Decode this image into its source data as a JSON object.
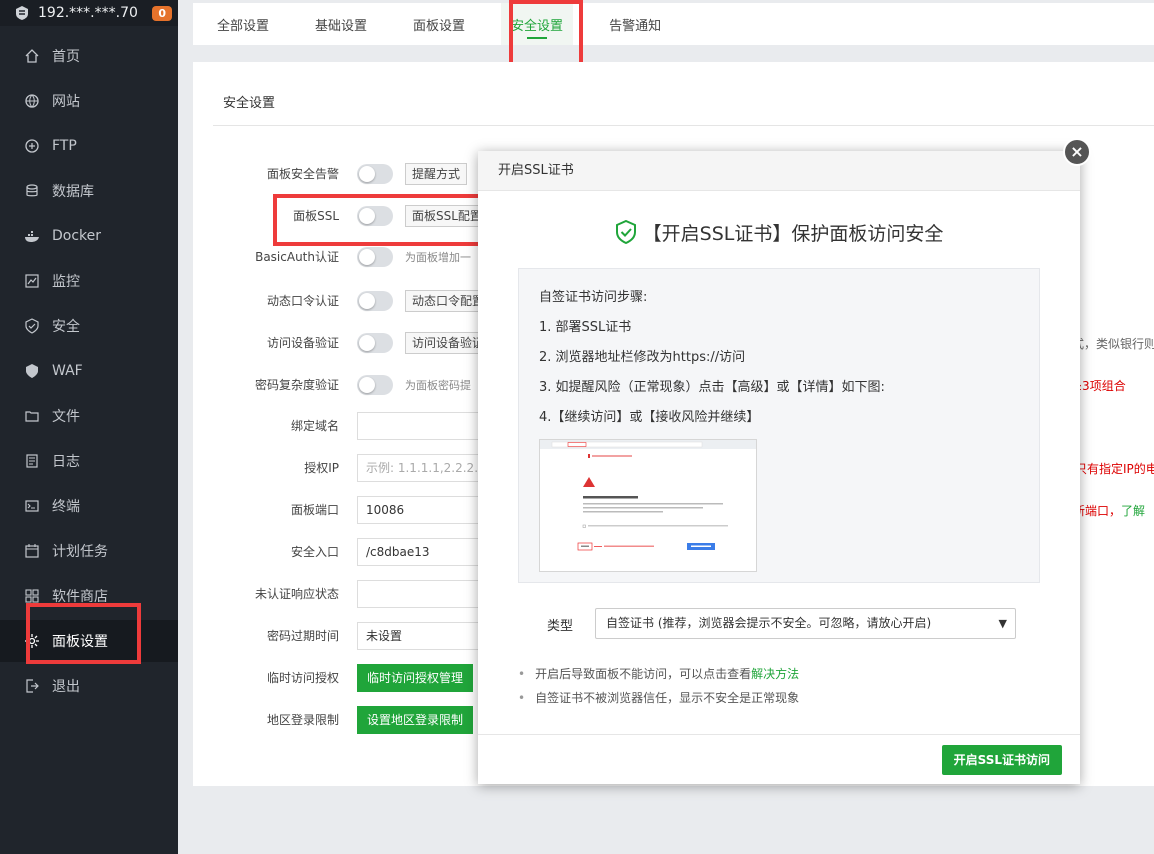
{
  "server": {
    "ip": "192.***.***.70",
    "badge": "0"
  },
  "sidebar": {
    "items": [
      {
        "label": "首页",
        "icon": "home-icon"
      },
      {
        "label": "网站",
        "icon": "globe-icon"
      },
      {
        "label": "FTP",
        "icon": "ftp-icon"
      },
      {
        "label": "数据库",
        "icon": "database-icon"
      },
      {
        "label": "Docker",
        "icon": "docker-icon"
      },
      {
        "label": "监控",
        "icon": "monitor-icon"
      },
      {
        "label": "安全",
        "icon": "shield-icon"
      },
      {
        "label": "WAF",
        "icon": "waf-shield-icon"
      },
      {
        "label": "文件",
        "icon": "folder-icon"
      },
      {
        "label": "日志",
        "icon": "log-icon"
      },
      {
        "label": "终端",
        "icon": "terminal-icon"
      },
      {
        "label": "计划任务",
        "icon": "calendar-icon"
      },
      {
        "label": "软件商店",
        "icon": "apps-icon"
      },
      {
        "label": "面板设置",
        "icon": "gear-icon",
        "active": true
      },
      {
        "label": "退出",
        "icon": "logout-icon"
      }
    ]
  },
  "tabs": [
    "全部设置",
    "基础设置",
    "面板设置",
    "安全设置",
    "告警通知"
  ],
  "active_tab": "安全设置",
  "panel": {
    "title": "安全设置",
    "rows": {
      "alert": {
        "label": "面板安全告警",
        "button": "提醒方式"
      },
      "ssl": {
        "label": "面板SSL",
        "button": "面板SSL配置"
      },
      "basicauth": {
        "label": "BasicAuth认证",
        "hint": "为面板增加一"
      },
      "totp": {
        "label": "动态口令认证",
        "button": "动态口令配置"
      },
      "device": {
        "label": "访问设备验证",
        "button": "访问设备验证",
        "right": "式，类似银行则"
      },
      "complexity": {
        "label": "密码复杂度验证",
        "hint": "为面板密码提",
        "right": "≥3项组合"
      },
      "domain": {
        "label": "绑定域名",
        "value": ""
      },
      "ip": {
        "label": "授权IP",
        "placeholder": "示例: 1.1.1.1,2.2.2.1-",
        "right": "只有指定IP的电"
      },
      "port": {
        "label": "面板端口",
        "value": "10086",
        "right_red": "新端口，",
        "right_green": "了解"
      },
      "entry": {
        "label": "安全入口",
        "value": "/c8dbae13"
      },
      "unauth": {
        "label": "未认证响应状态",
        "value": ""
      },
      "pwexpire": {
        "label": "密码过期时间",
        "value": "未设置"
      },
      "tempauth": {
        "label": "临时访问授权",
        "button": "临时访问授权管理"
      },
      "region": {
        "label": "地区登录限制",
        "button": "设置地区登录限制"
      }
    }
  },
  "modal": {
    "header": "开启SSL证书",
    "title": "【开启SSL证书】保护面板访问安全",
    "steps_title": "自签证书访问步骤:",
    "steps": [
      "1. 部署SSL证书",
      "2. 浏览器地址栏修改为https://访问",
      "3. 如提醒风险（正常现象）点击【高级】或【详情】如下图:",
      "4.【继续访问】或【接收风险并继续】"
    ],
    "type_label": "类型",
    "type_value": "自签证书 (推荐，浏览器会提示不安全。可忽略，请放心开启)",
    "notes": [
      {
        "text": "开启后导致面板不能访问，可以点击查看",
        "link": "解决方法"
      },
      {
        "text": "自签证书不被浏览器信任，显示不安全是正常现象"
      }
    ],
    "ok_button": "开启SSL证书访问",
    "close": "×"
  },
  "colors": {
    "accent": "#20a53a",
    "highlight": "#ee3b3b",
    "sidebar_bg": "#20252c"
  }
}
